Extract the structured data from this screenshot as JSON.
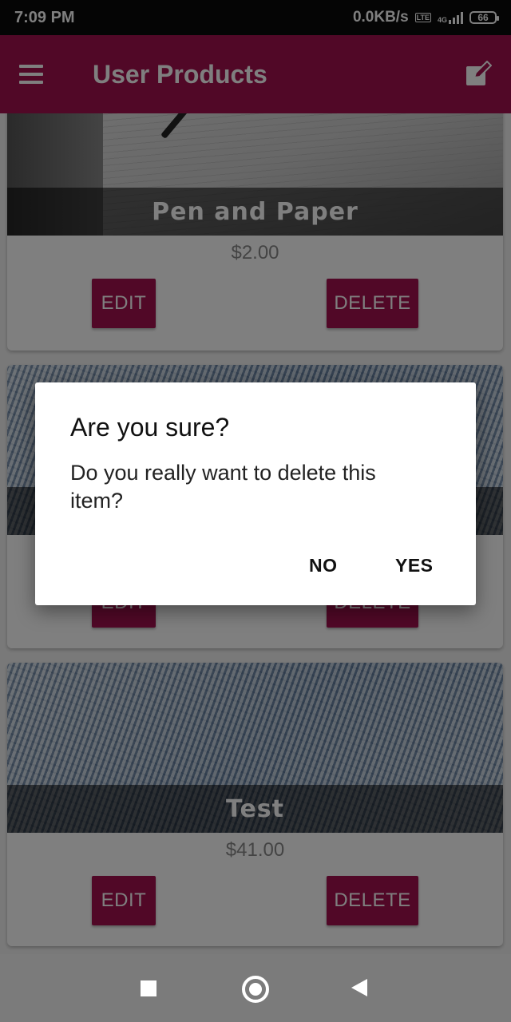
{
  "status_bar": {
    "time": "7:09 PM",
    "net_speed": "0.0KB/s",
    "volte": "Vo LTE",
    "network": "4G",
    "battery": "66"
  },
  "app_bar": {
    "title": "User Products",
    "menu_icon": "hamburger-menu-icon",
    "action_icon": "edit-square-icon"
  },
  "products": [
    {
      "title": "Pen and Paper",
      "price": "$2.00",
      "edit_label": "EDIT",
      "delete_label": "DELETE"
    },
    {
      "title": "",
      "price": "",
      "edit_label": "EDIT",
      "delete_label": "DELETE"
    },
    {
      "title": "Test",
      "price": "$41.00",
      "edit_label": "EDIT",
      "delete_label": "DELETE"
    }
  ],
  "dialog": {
    "title": "Are you sure?",
    "message": "Do you really want to delete this item?",
    "no_label": "NO",
    "yes_label": "YES"
  },
  "colors": {
    "primary": "#a3104e",
    "nav_bar": "#7b7b7b"
  }
}
